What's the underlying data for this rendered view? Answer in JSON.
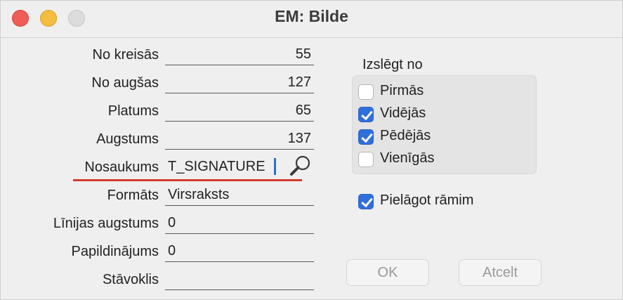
{
  "window": {
    "title": "EM: Bilde"
  },
  "form": {
    "no_kreisas": {
      "label": "No kreisās",
      "value": "55"
    },
    "no_augsas": {
      "label": "No augšas",
      "value": "127"
    },
    "platums": {
      "label": "Platums",
      "value": "65"
    },
    "augstums": {
      "label": "Augstums",
      "value": "137"
    },
    "nosaukums": {
      "label": "Nosaukums",
      "value": "T_SIGNATURE"
    },
    "formats": {
      "label": "Formāts",
      "value": "Virsraksts"
    },
    "linijas_augstums": {
      "label": "Līnijas augstums",
      "value": "0"
    },
    "papildinajums": {
      "label": "Papildinājums",
      "value": "0"
    },
    "stavoklis": {
      "label": "Stāvoklis",
      "value": ""
    }
  },
  "exclude": {
    "title": "Izslēgt no",
    "options": [
      {
        "label": "Pirmās",
        "checked": false
      },
      {
        "label": "Vidējās",
        "checked": true
      },
      {
        "label": "Pēdējās",
        "checked": true
      },
      {
        "label": "Vienīgās",
        "checked": false
      }
    ]
  },
  "fit_frames": {
    "label": "Pielāgot rāmim",
    "checked": true
  },
  "buttons": {
    "ok": "OK",
    "cancel": "Atcelt"
  },
  "colors": {
    "accent": "#2f6fdb",
    "close": "#ee5d57",
    "minimize": "#f4bd3f",
    "underline_highlight": "#d63a2b"
  }
}
